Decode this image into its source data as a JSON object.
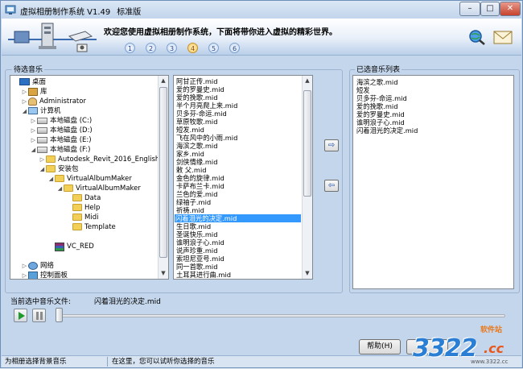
{
  "window": {
    "title": "虚拟相册制作系统 V1.49",
    "edition": "标准版",
    "controls": {
      "minimize": "–",
      "maximize": "□",
      "close": "✕"
    }
  },
  "header": {
    "welcome": "欢迎您使用虚拟相册制作系统，下面将带你进入虚拟的精彩世界。",
    "steps": [
      "1",
      "2",
      "3",
      "4",
      "5",
      "6"
    ],
    "active_step": "4",
    "icons": [
      "search-globe-icon",
      "mail-icon"
    ]
  },
  "left_panel": {
    "label": "待选音乐",
    "tree": [
      {
        "label": "桌面",
        "icon": "desktop",
        "depth": 0,
        "toggle": ""
      },
      {
        "label": "库",
        "icon": "library",
        "depth": 1,
        "toggle": "▷"
      },
      {
        "label": "Administrator",
        "icon": "user",
        "depth": 1,
        "toggle": "▷"
      },
      {
        "label": "计算机",
        "icon": "computer",
        "depth": 1,
        "toggle": "◢"
      },
      {
        "label": "本地磁盘 (C:)",
        "icon": "drive",
        "depth": 2,
        "toggle": "▷"
      },
      {
        "label": "本地磁盘 (D:)",
        "icon": "drive",
        "depth": 2,
        "toggle": "▷"
      },
      {
        "label": "本地磁盘 (E:)",
        "icon": "drive",
        "depth": 2,
        "toggle": "▷"
      },
      {
        "label": "本地磁盘 (F:)",
        "icon": "drive",
        "depth": 2,
        "toggle": "◢"
      },
      {
        "label": "Autodesk_Revit_2016_English",
        "icon": "folder",
        "depth": 3,
        "toggle": "▷"
      },
      {
        "label": "安装包",
        "icon": "folder",
        "depth": 3,
        "toggle": "◢"
      },
      {
        "label": "VirtualAlbumMaker",
        "icon": "folder",
        "depth": 4,
        "toggle": "◢"
      },
      {
        "label": "VirtualAlbumMaker",
        "icon": "folder",
        "depth": 5,
        "toggle": "◢"
      },
      {
        "label": "Data",
        "icon": "folder",
        "depth": 6,
        "toggle": ""
      },
      {
        "label": "Help",
        "icon": "folder",
        "depth": 6,
        "toggle": ""
      },
      {
        "label": "Midi",
        "icon": "folder",
        "depth": 6,
        "toggle": ""
      },
      {
        "label": "Template",
        "icon": "folder",
        "depth": 6,
        "toggle": ""
      },
      {
        "label": "",
        "icon": "",
        "depth": 0,
        "toggle": ""
      },
      {
        "label": "VC_RED",
        "icon": "rar",
        "depth": 4,
        "toggle": ""
      },
      {
        "label": "",
        "icon": "",
        "depth": 0,
        "toggle": ""
      },
      {
        "label": "网络",
        "icon": "network",
        "depth": 1,
        "toggle": "▷"
      },
      {
        "label": "控制面板",
        "icon": "control",
        "depth": 1,
        "toggle": "▷"
      }
    ],
    "files": [
      "阿甘正传.mid",
      "爱的罗曼史.mid",
      "爱的挽歌.mid",
      "半个月亮爬上来.mid",
      "贝多芬-命运.mid",
      "草原牧歌.mid",
      "短发.mid",
      "飞在风中的小雨.mid",
      "海滨之歌.mid",
      "家乡.mid",
      "剑侠情缘.mid",
      "敕 父.mid",
      "金色的旋律.mid",
      "卡萨布兰卡.mid",
      "兰色的爱.mid",
      "绿袖子.mid",
      "祈祷.mid",
      "闪着泪光的决定.mid",
      "生日歌.mid",
      "圣诞快乐.mid",
      "谁明浪子心.mid",
      "说声珍重.mid",
      "索坦尼亚号.mid",
      "同一首歌.mid",
      "土耳其进行曲.mid"
    ],
    "selected_file_index": 17
  },
  "transfer": {
    "add": "⇨",
    "remove": "⇦"
  },
  "right_panel": {
    "label": "已选音乐列表",
    "items": [
      "海滨之歌.mid",
      "短发",
      "贝多芬-命运.mid",
      "爱的挽歌.mid",
      "爱的罗曼史.mid",
      "谁明浪子心.mid",
      "闪着泪光的决定.mid"
    ]
  },
  "current": {
    "label": "当前选中音乐文件:",
    "value": "闪着泪光的决定.mid"
  },
  "footer": {
    "help_label": "帮助(H)",
    "status_left": "为相册选择背景音乐",
    "status_right": "在这里，您可以试听你选择的音乐"
  },
  "watermark": {
    "logo_text": "3322",
    "suffix": ".cc",
    "tag": "软件站",
    "site": "www.3322.cc"
  },
  "colors": {
    "window_bg": "#c4d6ec",
    "selection": "#3399ff",
    "active_step": "#f4c85a"
  }
}
